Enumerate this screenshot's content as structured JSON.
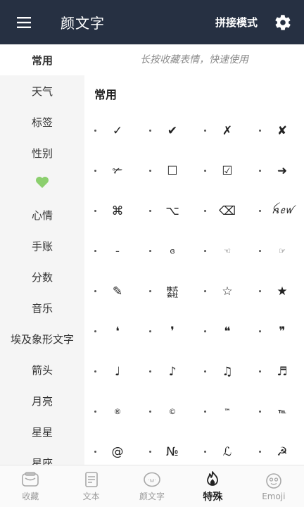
{
  "header": {
    "title": "颜文字",
    "mode_label": "拼接模式"
  },
  "hint": "长按收藏表情，快速使用",
  "sidebar": {
    "items": [
      {
        "label": "常用",
        "active": true
      },
      {
        "label": "天气"
      },
      {
        "label": "标签"
      },
      {
        "label": "性别"
      },
      {
        "label": "💚"
      },
      {
        "label": "心情"
      },
      {
        "label": "手账"
      },
      {
        "label": "分数"
      },
      {
        "label": "音乐"
      },
      {
        "label": "埃及象形文字"
      },
      {
        "label": "箭头"
      },
      {
        "label": "月亮"
      },
      {
        "label": "星星"
      },
      {
        "label": "星座"
      }
    ]
  },
  "section": {
    "title": "常用",
    "symbols": [
      "✓",
      "✔",
      "✗",
      "✘",
      "✃",
      "☐",
      "☑",
      "➜",
      "⌘",
      "⌥",
      "⌫",
      "ꫝꫀꪝ",
      "-",
      "ɞ",
      "☜",
      "☞",
      "✎",
      "㍿",
      "☆",
      "★",
      "❛",
      "❜",
      "❝",
      "❞",
      "♩",
      "♪",
      "♫",
      "♬",
      "®",
      "©",
      "™",
      "℡",
      "@",
      "№",
      "ℒ",
      "☭"
    ]
  },
  "bottom_nav": {
    "items": [
      {
        "label": "收藏",
        "icon": "favorites-icon"
      },
      {
        "label": "文本",
        "icon": "text-icon"
      },
      {
        "label": "颜文字",
        "icon": "kaomoji-icon"
      },
      {
        "label": "特殊",
        "icon": "fire-icon",
        "active": true
      },
      {
        "label": "Emoji",
        "icon": "emoji-face-icon"
      }
    ]
  },
  "colors": {
    "header_bg": "#263042",
    "sidebar_bg": "#f5f5f5",
    "heart": "#8ccf6e"
  }
}
